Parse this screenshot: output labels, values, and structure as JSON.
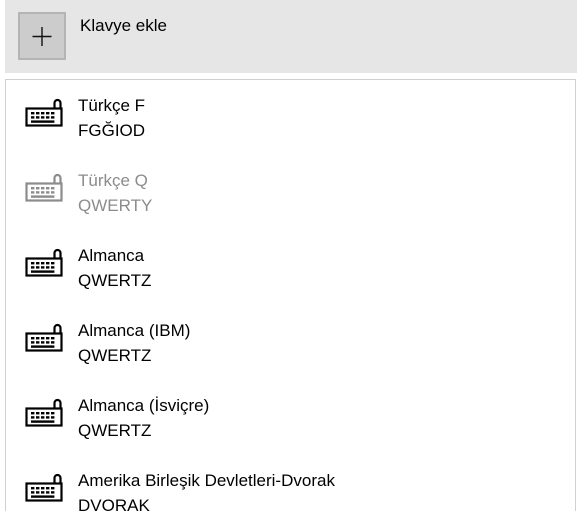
{
  "add_keyboard": {
    "label": "Klavye ekle",
    "icon": "plus-icon"
  },
  "keyboards": [
    {
      "name": "Türkçe F",
      "layout": "FGĞIOD",
      "icon": "keyboard-icon",
      "enabled": true
    },
    {
      "name": "Türkçe Q",
      "layout": "QWERTY",
      "icon": "keyboard-icon",
      "enabled": false
    },
    {
      "name": "Almanca",
      "layout": "QWERTZ",
      "icon": "keyboard-icon",
      "enabled": true
    },
    {
      "name": "Almanca (IBM)",
      "layout": "QWERTZ",
      "icon": "keyboard-icon",
      "enabled": true
    },
    {
      "name": "Almanca (İsviçre)",
      "layout": "QWERTZ",
      "icon": "keyboard-icon",
      "enabled": true
    },
    {
      "name": "Amerika Birleşik Devletleri-Dvorak",
      "layout": "DVORAK",
      "icon": "keyboard-icon",
      "enabled": true
    }
  ],
  "colors": {
    "header_background": "#e6e6e6",
    "plus_box_background": "#cccccc",
    "text": "#000000",
    "disabled_text": "#8c8c8c",
    "panel_border": "#d0d0d0"
  }
}
